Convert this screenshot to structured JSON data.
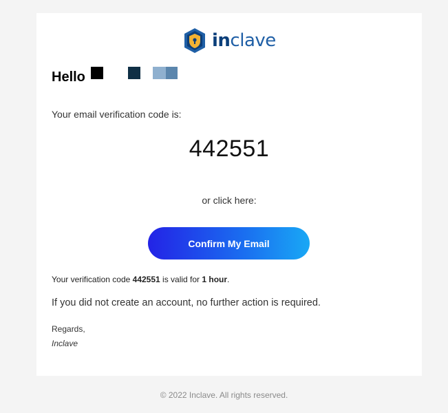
{
  "brand": {
    "logo_in": "in",
    "logo_rest": "clave",
    "shield_color": "#1f5fa6",
    "shield_accent": "#f2b233"
  },
  "greeting": {
    "label": "Hello"
  },
  "body": {
    "intro": "Your email verification code is:",
    "code": "442551",
    "or_click": "or click here:",
    "button_label": "Confirm My Email",
    "valid_prefix": "Your verification code ",
    "valid_code": "442551",
    "valid_middle": " is valid for ",
    "valid_duration": "1 hour",
    "valid_suffix": ".",
    "no_action": "If you did not create an account, no further action is required.",
    "regards": "Regards,",
    "signature": "Inclave"
  },
  "footer": {
    "copyright": "© 2022 Inclave. All rights reserved."
  },
  "colors": {
    "button_gradient_start": "#2323e6",
    "button_gradient_end": "#19a8f5",
    "redact_1": "#000000",
    "redact_2": "#0f2f45",
    "redact_3": "#8fb0cf",
    "redact_4": "#5b86ad"
  }
}
